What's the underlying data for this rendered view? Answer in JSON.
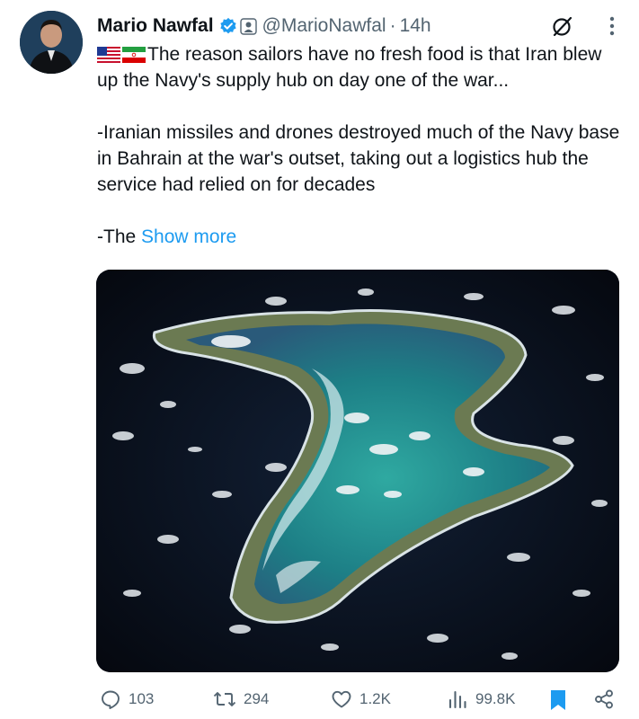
{
  "tweet": {
    "author_name": "Mario Nawfal",
    "handle": "@MarioNawfal",
    "separator": "·",
    "time": "14h",
    "flags": [
      "us-flag",
      "iran-flag"
    ],
    "lines": [
      "The reason sailors have no fresh food is that Iran blew up the Navy's supply hub on day one of the war...",
      "-Iranian missiles and drones destroyed much of the Navy base in Bahrain at the war's outset, taking out a logistics hub the service had relied on for decades"
    ],
    "truncated_prefix": "-The",
    "show_more_label": "Show more",
    "media_icon": "aerial-atoll-photo"
  },
  "stats": {
    "replies": "103",
    "reposts": "294",
    "likes": "1.2K",
    "views": "99.8K"
  },
  "colors": {
    "link": "#1d9bf0",
    "muted": "#536471",
    "verified": "#1d9bf0",
    "bookmark_active": "#1d9bf0"
  },
  "icons": [
    "verified-badge-icon",
    "affiliate-badge-icon",
    "grok-icon",
    "more-icon",
    "reply-icon",
    "repost-icon",
    "like-icon",
    "views-icon",
    "bookmark-icon",
    "share-icon"
  ]
}
